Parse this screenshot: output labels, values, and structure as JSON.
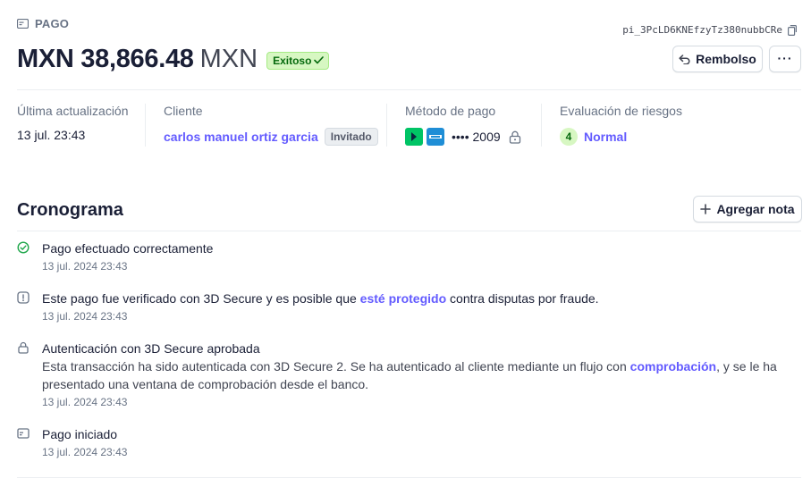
{
  "header": {
    "label": "PAGO",
    "payment_id": "pi_3PcLD6KNEfzyTz380nubbCRe",
    "amount": "MXN 38,866.48",
    "currency": "MXN",
    "status": "Exitoso",
    "refund_label": "Rembolso",
    "more_label": "···"
  },
  "meta": {
    "updated_label": "Última actualización",
    "updated_value": "13 jul. 23:43",
    "customer_label": "Cliente",
    "customer_name": "carlos manuel ortiz garcia",
    "customer_badge": "Invitado",
    "payment_method_label": "Método de pago",
    "payment_method_value": "•••• 2009",
    "risk_label": "Evaluación de riesgos",
    "risk_score": "4",
    "risk_value": "Normal"
  },
  "timeline": {
    "title": "Cronograma",
    "add_note_label": "Agregar nota",
    "events": [
      {
        "title": "Pago efectuado correctamente",
        "time": "13 jul. 2024 23:43"
      },
      {
        "title_pre": "Este pago fue verificado con 3D Secure y es posible que ",
        "title_link": "esté protegido",
        "title_post": " contra disputas por fraude.",
        "time": "13 jul. 2024 23:43"
      },
      {
        "title": "Autenticación con 3D Secure aprobada",
        "desc_pre": "Esta transacción ha sido autenticada con 3D Secure 2. Se ha autenticado al cliente mediante un flujo con ",
        "desc_link": "comprobación",
        "desc_post": ", y se le ha presentado una ventana de comprobación desde el banco.",
        "time": "13 jul. 2024 23:43"
      },
      {
        "title": "Pago iniciado",
        "time": "13 jul. 2024 23:43"
      }
    ]
  },
  "colors": {
    "accent": "#635bff",
    "success_bg": "#d7f7c2",
    "success_text": "#05690d",
    "muted_text": "#687385"
  },
  "icons": {
    "header": "payment-card-icon",
    "copy": "copy-icon",
    "refund": "undo-arrow-icon",
    "status": "check-icon",
    "lock": "lock-icon",
    "add": "plus-icon",
    "event_success": "check-circle-icon",
    "event_info": "info-icon",
    "event_lock": "lock-icon",
    "event_start": "payment-card-icon"
  }
}
